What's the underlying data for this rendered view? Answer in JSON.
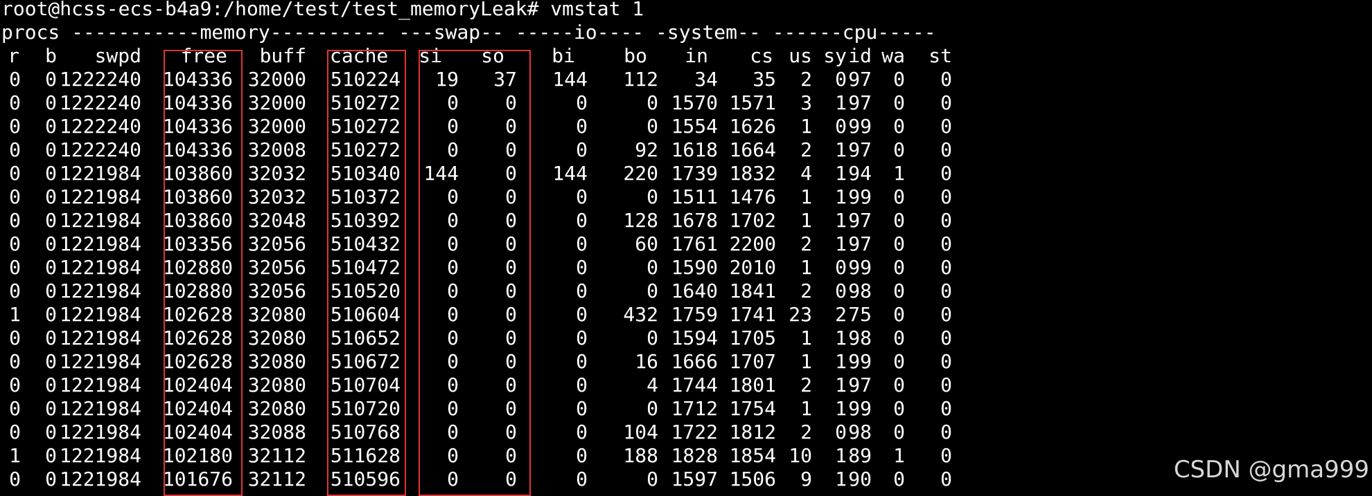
{
  "prompt_line": "root@hcss-ecs-b4a9:/home/test/test_memoryLeak# vmstat 1",
  "group_header": "procs -----------memory---------- ---swap-- -----io---- -system-- ------cpu-----",
  "columns": [
    "r",
    "b",
    "swpd",
    "free",
    "buff",
    "cache",
    "si",
    "so",
    "bi",
    "bo",
    "in",
    "cs",
    "us",
    "sy",
    "id",
    "wa",
    "st"
  ],
  "rows": [
    [
      "0",
      "0",
      "1222240",
      "104336",
      "32000",
      "510224",
      "19",
      "37",
      "144",
      "112",
      "34",
      "35",
      "2",
      "0",
      "97",
      "0",
      "0"
    ],
    [
      "0",
      "0",
      "1222240",
      "104336",
      "32000",
      "510272",
      "0",
      "0",
      "0",
      "0",
      "1570",
      "1571",
      "3",
      "1",
      "97",
      "0",
      "0"
    ],
    [
      "0",
      "0",
      "1222240",
      "104336",
      "32000",
      "510272",
      "0",
      "0",
      "0",
      "0",
      "1554",
      "1626",
      "1",
      "0",
      "99",
      "0",
      "0"
    ],
    [
      "0",
      "0",
      "1222240",
      "104336",
      "32008",
      "510272",
      "0",
      "0",
      "0",
      "92",
      "1618",
      "1664",
      "2",
      "1",
      "97",
      "0",
      "0"
    ],
    [
      "0",
      "0",
      "1221984",
      "103860",
      "32032",
      "510340",
      "144",
      "0",
      "144",
      "220",
      "1739",
      "1832",
      "4",
      "1",
      "94",
      "1",
      "0"
    ],
    [
      "0",
      "0",
      "1221984",
      "103860",
      "32032",
      "510372",
      "0",
      "0",
      "0",
      "0",
      "1511",
      "1476",
      "1",
      "1",
      "99",
      "0",
      "0"
    ],
    [
      "0",
      "0",
      "1221984",
      "103860",
      "32048",
      "510392",
      "0",
      "0",
      "0",
      "128",
      "1678",
      "1702",
      "1",
      "1",
      "97",
      "0",
      "0"
    ],
    [
      "0",
      "0",
      "1221984",
      "103356",
      "32056",
      "510432",
      "0",
      "0",
      "0",
      "60",
      "1761",
      "2200",
      "2",
      "1",
      "97",
      "0",
      "0"
    ],
    [
      "0",
      "0",
      "1221984",
      "102880",
      "32056",
      "510472",
      "0",
      "0",
      "0",
      "0",
      "1590",
      "2010",
      "1",
      "0",
      "99",
      "0",
      "0"
    ],
    [
      "0",
      "0",
      "1221984",
      "102880",
      "32056",
      "510520",
      "0",
      "0",
      "0",
      "0",
      "1640",
      "1841",
      "2",
      "0",
      "98",
      "0",
      "0"
    ],
    [
      "1",
      "0",
      "1221984",
      "102628",
      "32080",
      "510604",
      "0",
      "0",
      "0",
      "432",
      "1759",
      "1741",
      "23",
      "2",
      "75",
      "0",
      "0"
    ],
    [
      "0",
      "0",
      "1221984",
      "102628",
      "32080",
      "510652",
      "0",
      "0",
      "0",
      "0",
      "1594",
      "1705",
      "1",
      "1",
      "98",
      "0",
      "0"
    ],
    [
      "0",
      "0",
      "1221984",
      "102628",
      "32080",
      "510672",
      "0",
      "0",
      "0",
      "16",
      "1666",
      "1707",
      "1",
      "1",
      "99",
      "0",
      "0"
    ],
    [
      "0",
      "0",
      "1221984",
      "102404",
      "32080",
      "510704",
      "0",
      "0",
      "0",
      "4",
      "1744",
      "1801",
      "2",
      "1",
      "97",
      "0",
      "0"
    ],
    [
      "0",
      "0",
      "1221984",
      "102404",
      "32080",
      "510720",
      "0",
      "0",
      "0",
      "0",
      "1712",
      "1754",
      "1",
      "1",
      "99",
      "0",
      "0"
    ],
    [
      "0",
      "0",
      "1221984",
      "102404",
      "32088",
      "510768",
      "0",
      "0",
      "0",
      "104",
      "1722",
      "1812",
      "2",
      "0",
      "98",
      "0",
      "0"
    ],
    [
      "1",
      "0",
      "1221984",
      "102180",
      "32112",
      "511628",
      "0",
      "0",
      "0",
      "188",
      "1828",
      "1854",
      "10",
      "1",
      "89",
      "1",
      "0"
    ],
    [
      "0",
      "0",
      "1221984",
      "101676",
      "32112",
      "510596",
      "0",
      "0",
      "0",
      "0",
      "1597",
      "1506",
      "9",
      "1",
      "90",
      "0",
      "0"
    ]
  ],
  "highlighted_columns": [
    "free",
    "cache",
    "si-so"
  ],
  "highlight_color": "#e23434",
  "terminal_bg": "#000000",
  "terminal_fg": "#ffffff",
  "watermark": "CSDN @gma999"
}
